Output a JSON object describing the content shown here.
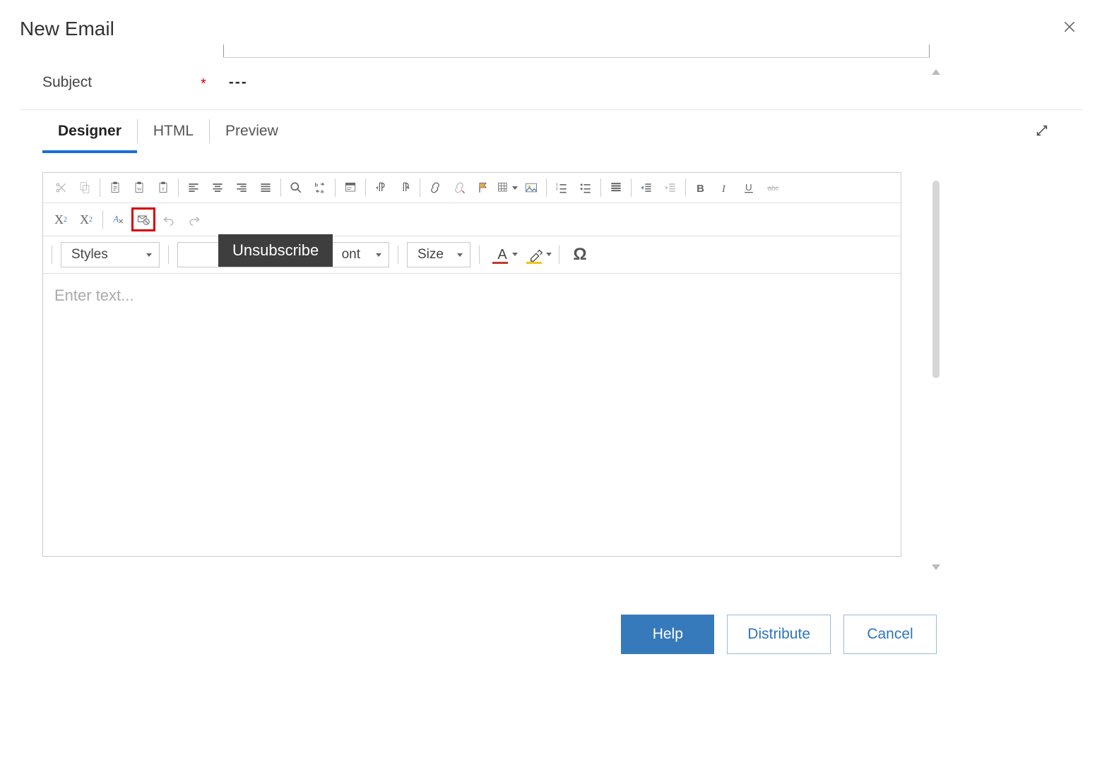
{
  "header": {
    "title": "New Email"
  },
  "subject": {
    "label": "Subject",
    "required_mark": "*",
    "value": "---"
  },
  "tabs": {
    "designer": "Designer",
    "html": "HTML",
    "preview": "Preview",
    "active": "designer"
  },
  "toolbar": {
    "tooltip_unsubscribe": "Unsubscribe",
    "dropdowns": {
      "styles_label": "Styles",
      "font_visible_fragment": "ont",
      "size_label": "Size"
    }
  },
  "editor": {
    "placeholder": "Enter text..."
  },
  "footer": {
    "help": "Help",
    "distribute": "Distribute",
    "cancel": "Cancel"
  }
}
